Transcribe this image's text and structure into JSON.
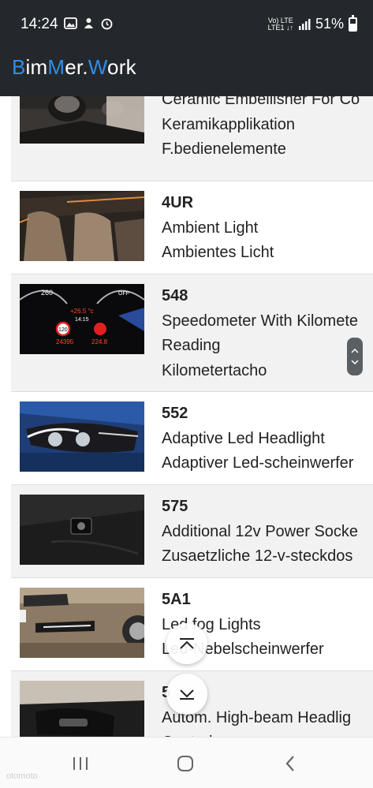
{
  "status_bar": {
    "time": "14:24",
    "network_top": "Vo) LTE",
    "network_bottom": "LTE1 ↓↑",
    "battery": "51%",
    "battery_level": 0.51
  },
  "app": {
    "brand_parts": [
      "B",
      "im",
      "M",
      "er.",
      "W",
      "ork"
    ]
  },
  "options": [
    {
      "code": "",
      "line1": "Ceramic Embellisher For Co",
      "line2": "Keramikapplikation",
      "line3": "F.bedienelemente",
      "thumb": "ceramic-controls-photo"
    },
    {
      "code": "4UR",
      "line1": "Ambient Light",
      "line2": "Ambientes Licht",
      "line3": "",
      "thumb": "ambient-light-photo"
    },
    {
      "code": "548",
      "line1": "Speedometer With Kilomete",
      "line2": "Reading",
      "line3": "Kilometertacho",
      "thumb": "speedometer-photo",
      "gauge": {
        "left": "260",
        "right": "OFF",
        "temp": "+26.5 °c",
        "clock": "14:15",
        "speed": "120",
        "odo": "24395",
        "trip": "224.8"
      }
    },
    {
      "code": "552",
      "line1": "Adaptive Led Headlight",
      "line2": "Adaptiver Led-scheinwerfer",
      "line3": "",
      "thumb": "headlight-photo"
    },
    {
      "code": "575",
      "line1": "Additional 12v Power Socke",
      "line2": "Zusaetzliche 12-v-steckdos",
      "line3": "",
      "thumb": "power-socket-photo"
    },
    {
      "code": "5A1",
      "line1": "Led fog Lights",
      "line2": "Led-Nebelscheinwerfer",
      "line3": "",
      "thumb": "fog-lights-photo"
    },
    {
      "code": "5",
      "line1": "Autom. High-beam Headlig",
      "line2": "Control",
      "line3": "",
      "thumb": "high-beam-photo"
    }
  ],
  "colors": {
    "header_bg": "#24282c",
    "brand_accent": "#2f8ee8",
    "row_shaded": "#f2f2f2"
  },
  "nav": {
    "recents": "recents-icon",
    "home": "home-icon",
    "back": "back-icon"
  },
  "watermark": "otomoto"
}
